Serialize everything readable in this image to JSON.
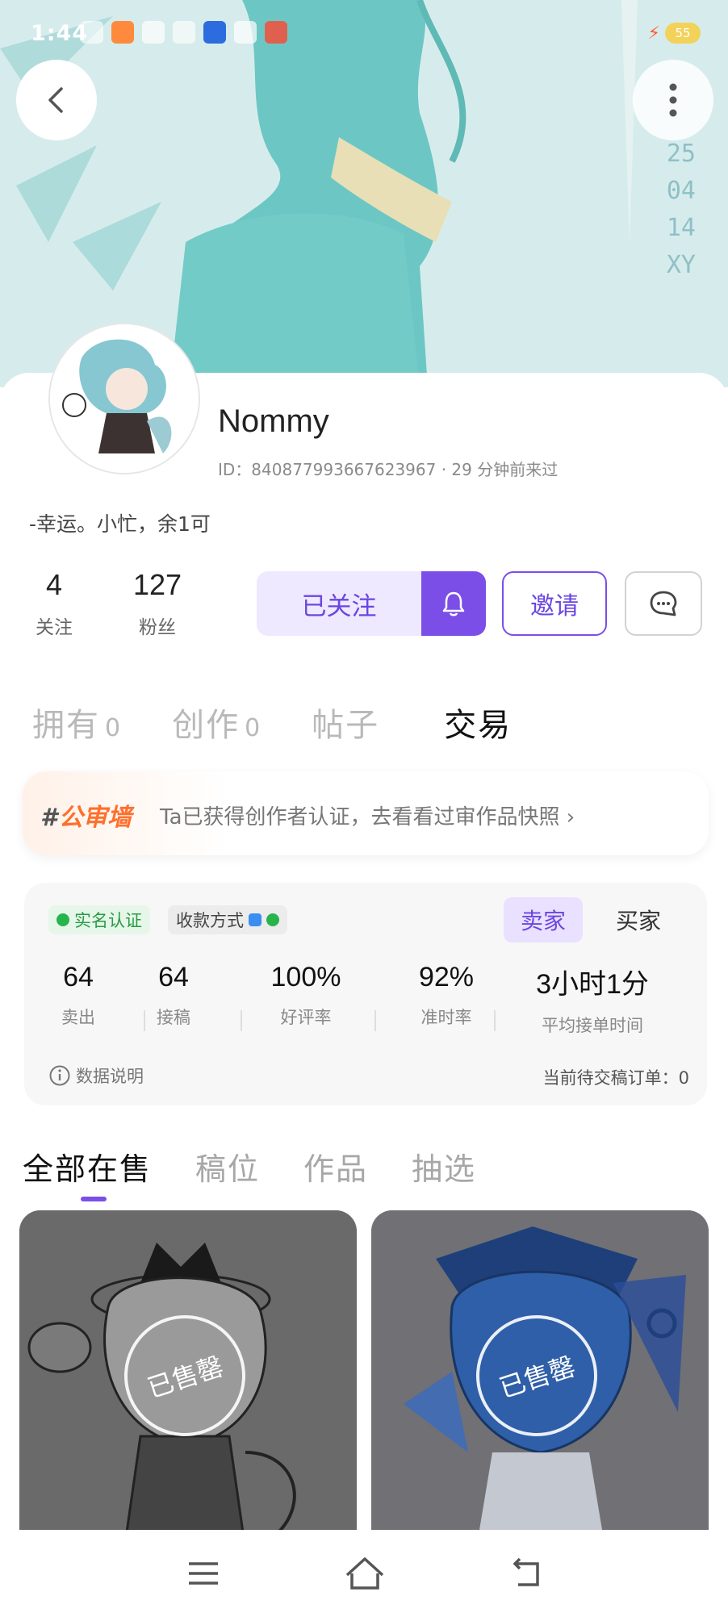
{
  "status_bar": {
    "time": "1:44",
    "battery": "55"
  },
  "banner": {
    "signature": [
      "25",
      "04",
      "14",
      "XY"
    ]
  },
  "profile": {
    "username": "Nommy",
    "id_line": "ID：840877993667623967 · 29 分钟前来过",
    "bio": "-幸运。小忙，余1可"
  },
  "stats": [
    {
      "value": "4",
      "label": "关注"
    },
    {
      "value": "127",
      "label": "粉丝"
    }
  ],
  "actions": {
    "follow_label": "已关注",
    "invite_label": "邀请"
  },
  "main_tabs": [
    {
      "label": "拥有",
      "suffix": "0"
    },
    {
      "label": "创作",
      "suffix": "0"
    },
    {
      "label": "帖子",
      "suffix": ""
    },
    {
      "label": "交易",
      "suffix": ""
    }
  ],
  "audit_banner": {
    "tag_hash": "#",
    "tag": "公审墙",
    "text": "Ta已获得创作者认证，去看看过审作品快照 ›"
  },
  "trade": {
    "badge_real": "实名认证",
    "badge_pay": "收款方式",
    "role_seller": "卖家",
    "role_buyer": "买家",
    "metrics": [
      {
        "value": "64",
        "label": "卖出"
      },
      {
        "value": "64",
        "label": "接稿"
      },
      {
        "value": "100%",
        "label": "好评率"
      },
      {
        "value": "92%",
        "label": "准时率"
      },
      {
        "value": "3小时1分",
        "label": "平均接单时间"
      }
    ],
    "data_note": "数据说明",
    "pending": "当前待交稿订单：0"
  },
  "sub_tabs": [
    "全部在售",
    "稿位",
    "作品",
    "抽选"
  ],
  "products": [
    {
      "sold_label": "已售罄"
    },
    {
      "sold_label": "已售罄"
    }
  ],
  "colors": {
    "accent": "#7b4ee8",
    "accent_light": "#eee9ff",
    "banner_teal": "#6cc7c4"
  }
}
